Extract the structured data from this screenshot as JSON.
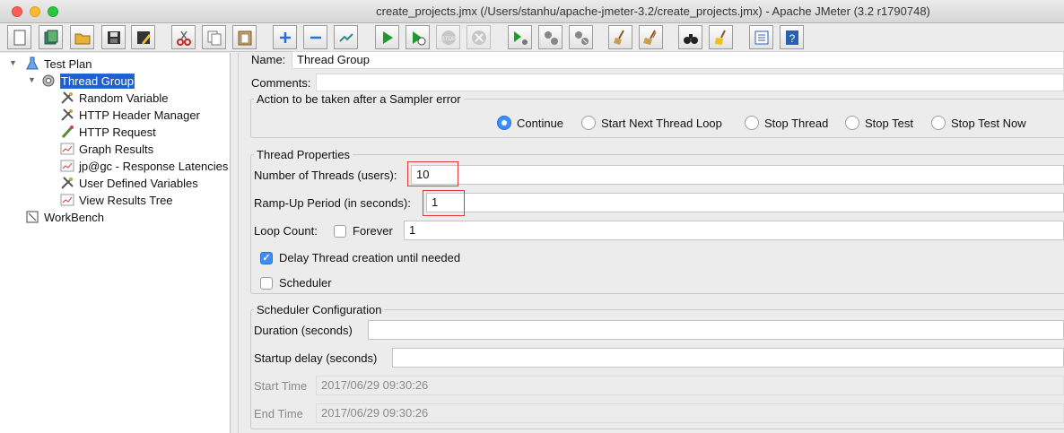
{
  "window": {
    "title": "create_projects.jmx (/Users/stanhu/apache-jmeter-3.2/create_projects.jmx) - Apache JMeter (3.2 r1790748)"
  },
  "toolbar": {
    "buttons": [
      {
        "name": "new",
        "icon": "new-document-icon"
      },
      {
        "name": "templates",
        "icon": "templates-icon"
      },
      {
        "name": "open",
        "icon": "folder-open-icon"
      },
      {
        "name": "save",
        "icon": "save-icon"
      },
      {
        "name": "save-as",
        "icon": "save-as-icon"
      },
      {
        "name": "cut",
        "icon": "scissors-icon"
      },
      {
        "name": "copy",
        "icon": "copy-icon"
      },
      {
        "name": "paste",
        "icon": "paste-icon"
      },
      {
        "name": "expand",
        "icon": "plus-icon"
      },
      {
        "name": "collapse",
        "icon": "minus-icon"
      },
      {
        "name": "toggle",
        "icon": "toggle-icon"
      },
      {
        "name": "start",
        "icon": "play-icon"
      },
      {
        "name": "start-no-pauses",
        "icon": "play-no-timers-icon"
      },
      {
        "name": "stop",
        "icon": "stop-icon"
      },
      {
        "name": "shutdown",
        "icon": "shutdown-icon"
      },
      {
        "name": "remote-start",
        "icon": "remote-start-icon"
      },
      {
        "name": "remote-stop",
        "icon": "remote-stop-icon"
      },
      {
        "name": "remote-shutdown",
        "icon": "remote-shutdown-icon"
      },
      {
        "name": "clear",
        "icon": "broom-clear-icon"
      },
      {
        "name": "clear-all",
        "icon": "broom-clear-all-icon"
      },
      {
        "name": "search",
        "icon": "binoculars-icon"
      },
      {
        "name": "reset-search",
        "icon": "reset-search-broom-icon"
      },
      {
        "name": "function-helper",
        "icon": "function-list-icon"
      },
      {
        "name": "help",
        "icon": "help-icon"
      }
    ]
  },
  "tree": {
    "test_plan": "Test Plan",
    "thread_group": "Thread Group",
    "children": [
      {
        "label": "Random Variable",
        "icon": "wrench-icon"
      },
      {
        "label": "HTTP Header Manager",
        "icon": "wrench-icon"
      },
      {
        "label": "HTTP Request",
        "icon": "sampler-pipette-icon"
      },
      {
        "label": "Graph Results",
        "icon": "graph-icon"
      },
      {
        "label": "jp@gc - Response Latencies",
        "icon": "graph-icon"
      },
      {
        "label": "User Defined Variables",
        "icon": "wrench-icon"
      },
      {
        "label": "View Results Tree",
        "icon": "graph-icon"
      }
    ],
    "workbench": "WorkBench"
  },
  "form": {
    "name_label": "Name:",
    "name_value": "Thread Group",
    "comments_label": "Comments:",
    "comments_value": "",
    "sampler_error": {
      "title": "Action to be taken after a Sampler error",
      "options": [
        "Continue",
        "Start Next Thread Loop",
        "Stop Thread",
        "Stop Test",
        "Stop Test Now"
      ],
      "selected": "Continue"
    },
    "thread_properties": {
      "title": "Thread Properties",
      "threads_label": "Number of Threads (users):",
      "threads_value": "10",
      "rampup_label": "Ramp-Up Period (in seconds):",
      "rampup_value": "1",
      "loop_label": "Loop Count:",
      "forever_label": "Forever",
      "forever_checked": false,
      "loop_value": "1",
      "delay_label": "Delay Thread creation until needed",
      "delay_checked": true,
      "scheduler_label": "Scheduler",
      "scheduler_checked": false
    },
    "scheduler": {
      "title": "Scheduler Configuration",
      "duration_label": "Duration (seconds)",
      "duration_value": "",
      "startup_label": "Startup delay (seconds)",
      "startup_value": "",
      "start_label": "Start Time",
      "start_value": "2017/06/29 09:30:26",
      "end_label": "End Time",
      "end_value": "2017/06/29 09:30:26"
    }
  },
  "colors": {
    "selection": "#1f5fd0",
    "highlight_box": "#e03a3a",
    "radio_on": "#3d8ef5"
  }
}
